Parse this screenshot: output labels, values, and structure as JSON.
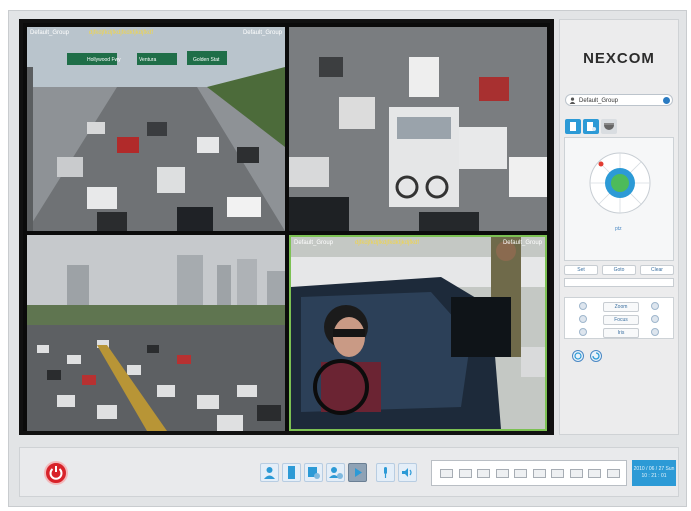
{
  "app": {
    "brand": "NEXCOM"
  },
  "video": {
    "cells": [
      {
        "left_label": "Default_Group",
        "mid_label": "djfkdjfkdjfkdjfkdkfjkdjfkdf",
        "right_label": "Default_Group"
      },
      {
        "left_label": "",
        "mid_label": "",
        "right_label": ""
      },
      {
        "left_label": "",
        "mid_label": "",
        "right_label": ""
      },
      {
        "left_label": "Default_Group",
        "mid_label": "djfkdjfkdjfkdjfkdkfjkdjfkdf",
        "right_label": "Default_Group"
      }
    ],
    "highway_signs": [
      "Hollywood Fwy",
      "Ventura",
      "Golden Stat"
    ]
  },
  "sidebar": {
    "group_select": "Default_Group",
    "tabs": [
      "document-icon",
      "document-settings-icon",
      "camera-dome-icon"
    ],
    "ptz_link": "ptz",
    "buttons": [
      "Set",
      "Goto",
      "Clear"
    ],
    "zoom_controls": [
      "Zoom",
      "Focus",
      "Iris"
    ],
    "round_buttons": [
      "refresh-icon",
      "rotate-icon"
    ]
  },
  "toolbar": {
    "tools": [
      "user-icon",
      "document-icon",
      "search-person-icon",
      "playback-person-icon",
      "play-icon",
      "microphone-icon",
      "speaker-icon"
    ],
    "active_tool": "play-icon",
    "layouts": [
      "1x1",
      "2x2",
      "1+5",
      "3x3",
      "1+7",
      "4x4",
      "1+12",
      "5x5",
      "6x6",
      "full"
    ],
    "datetime": {
      "date": "2010 / 06 / 27 Sun",
      "time": "10 : 21 : 01"
    }
  },
  "colors": {
    "accent": "#2c9ad6",
    "power": "#d8232a",
    "active_frame": "#7cc153",
    "label_yellow": "#f1d54a"
  }
}
